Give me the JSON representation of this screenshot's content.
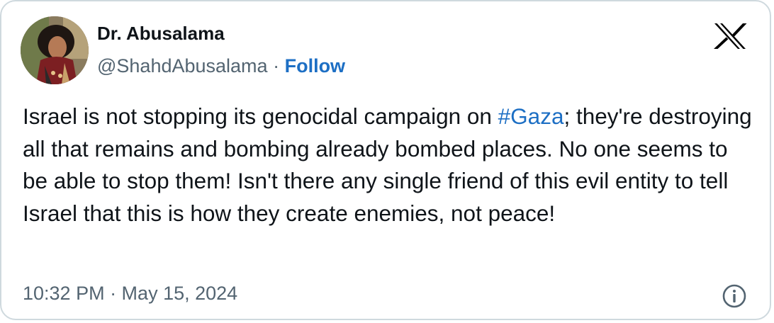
{
  "author": {
    "display_name": "Dr. Abusalama",
    "handle": "@ShahdAbusalama",
    "separator": "·",
    "follow_label": "Follow"
  },
  "tweet": {
    "text_before_hashtag": "Israel is not stopping its genocidal campaign on ",
    "hashtag": "#Gaza",
    "text_after_hashtag": "; they're destroying all that remains and bombing already bombed places. No one seems to be able to stop them! Isn't there any single friend of this evil entity to tell Israel that this is how they create enemies, not peace!",
    "timestamp": "10:32 PM · May 15, 2024"
  },
  "icons": {
    "platform_logo": "x-logo-icon",
    "info": "info-icon"
  },
  "colors": {
    "link": "#1d6fc4",
    "text": "#0f1419",
    "secondary_text": "#536471",
    "border": "#cfd9de"
  }
}
